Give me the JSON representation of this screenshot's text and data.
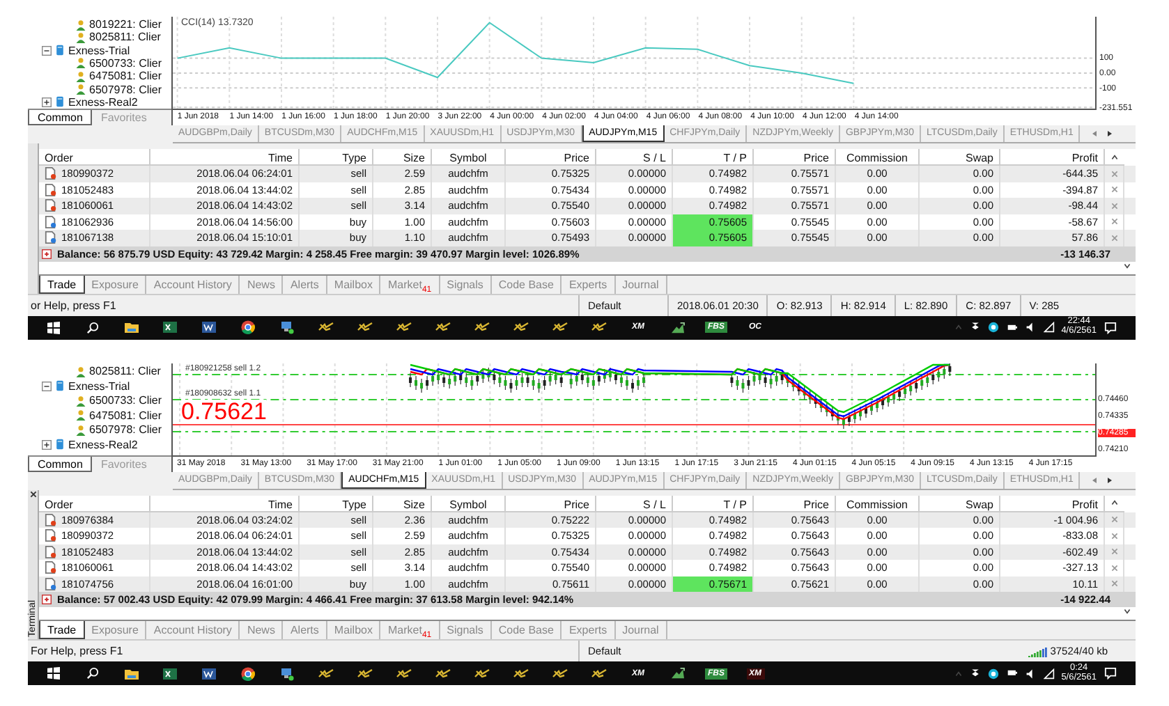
{
  "screens": [
    {
      "navigator": {
        "items": [
          {
            "label": "8019221: Clier",
            "kind": "account"
          },
          {
            "label": "8025811: Clier",
            "kind": "account"
          },
          {
            "label": "Exness-Trial",
            "kind": "server",
            "expanded": true,
            "children": [
              {
                "label": "6500733: Clier",
                "kind": "account"
              },
              {
                "label": "6475081: Clier",
                "kind": "account"
              },
              {
                "label": "6507978: Clier",
                "kind": "account"
              }
            ]
          },
          {
            "label": "Exness-Real2",
            "kind": "server",
            "expanded": false
          }
        ],
        "tabs": [
          {
            "label": "Common",
            "selected": true
          },
          {
            "label": "Favorites",
            "selected": false
          }
        ]
      },
      "chart": {
        "kind": "indicator",
        "legend_value": "13.7320",
        "chart_data": {
          "type": "line",
          "ylim": [
            -240,
            380
          ],
          "grid": true,
          "categories": [
            "1 Jun 2018",
            "1 Jun 14:00",
            "1 Jun 16:00",
            "1 Jun 18:00",
            "1 Jun 20:00",
            "3 Jun 22:00",
            "4 Jun 00:00",
            "4 Jun 02:00",
            "4 Jun 04:00",
            "4 Jun 06:00",
            "4 Jun 08:00",
            "4 Jun 10:00",
            "4 Jun 12:00",
            "4 Jun 14:00"
          ],
          "yticks": [
            {
              "value": 100,
              "label": "100"
            },
            {
              "value": 0,
              "label": "0.00"
            },
            {
              "value": -100,
              "label": "-100"
            },
            {
              "value": -231.551,
              "label": "-231.551"
            }
          ],
          "series": [
            {
              "name": "CCI(14)",
              "color": "#49c9c0",
              "values": [
                100,
                170,
                100,
                100,
                100,
                -30,
                340,
                100,
                70,
                170,
                160,
                50,
                0,
                -70
              ]
            }
          ]
        }
      },
      "chart_tabs": [
        {
          "label": "AUDGBPm,Daily",
          "selected": false
        },
        {
          "label": "BTCUSDm,M30",
          "selected": false
        },
        {
          "label": "AUDCHFm,M15",
          "selected": false
        },
        {
          "label": "XAUUSDm,H1",
          "selected": false
        },
        {
          "label": "USDJPYm,M30",
          "selected": false
        },
        {
          "label": "AUDJPYm,M15",
          "selected": true
        },
        {
          "label": "CHFJPYm,Daily",
          "selected": false
        },
        {
          "label": "NZDJPYm,Weekly",
          "selected": false
        },
        {
          "label": "GBPJPYm,M30",
          "selected": false
        },
        {
          "label": "LTCUSDm,Daily",
          "selected": false
        },
        {
          "label": "ETHUSDm,H1",
          "selected": false
        }
      ],
      "table": {
        "columns": [
          "Order",
          "Time",
          "Type",
          "Size",
          "Symbol",
          "Price",
          "S / L",
          "T / P",
          "Price",
          "Commission",
          "Swap",
          "Profit"
        ],
        "rows": [
          {
            "kind": "sell",
            "order": "180990372",
            "time": "2018.06.04 06:24:01",
            "type": "sell",
            "size": "2.59",
            "symbol": "audchfm",
            "price": "0.75325",
            "sl": "0.00000",
            "tp": "0.74982",
            "tp_hit": false,
            "current": "0.75571",
            "commission": "0.00",
            "swap": "0.00",
            "profit": "-644.35"
          },
          {
            "kind": "sell",
            "order": "181052483",
            "time": "2018.06.04 13:44:02",
            "type": "sell",
            "size": "2.85",
            "symbol": "audchfm",
            "price": "0.75434",
            "sl": "0.00000",
            "tp": "0.74982",
            "tp_hit": false,
            "current": "0.75571",
            "commission": "0.00",
            "swap": "0.00",
            "profit": "-394.87"
          },
          {
            "kind": "sell",
            "order": "181060061",
            "time": "2018.06.04 14:43:02",
            "type": "sell",
            "size": "3.14",
            "symbol": "audchfm",
            "price": "0.75540",
            "sl": "0.00000",
            "tp": "0.74982",
            "tp_hit": false,
            "current": "0.75571",
            "commission": "0.00",
            "swap": "0.00",
            "profit": "-98.44"
          },
          {
            "kind": "buy",
            "order": "181062936",
            "time": "2018.06.04 14:56:00",
            "type": "buy",
            "size": "1.00",
            "symbol": "audchfm",
            "price": "0.75603",
            "sl": "0.00000",
            "tp": "0.75605",
            "tp_hit": true,
            "current": "0.75545",
            "commission": "0.00",
            "swap": "0.00",
            "profit": "-58.67"
          },
          {
            "kind": "buy",
            "order": "181067138",
            "time": "2018.06.04 15:10:01",
            "type": "buy",
            "size": "1.10",
            "symbol": "audchfm",
            "price": "0.75493",
            "sl": "0.00000",
            "tp": "0.75605",
            "tp_hit": true,
            "current": "0.75545",
            "commission": "0.00",
            "swap": "0.00",
            "profit": "57.86"
          }
        ],
        "summary": "Balance: 56 875.79 USD  Equity: 43 729.42  Margin: 4 258.45  Free margin: 39 470.97  Margin level: 1026.89%",
        "total": "-13 146.37"
      },
      "terminal_tabs": [
        {
          "label": "Trade",
          "selected": true
        },
        {
          "label": "Exposure",
          "selected": false
        },
        {
          "label": "Account History",
          "selected": false
        },
        {
          "label": "News",
          "selected": false
        },
        {
          "label": "Alerts",
          "selected": false
        },
        {
          "label": "Mailbox",
          "selected": false
        },
        {
          "label": "Market",
          "badge": "41",
          "selected": false
        },
        {
          "label": "Signals",
          "selected": false
        },
        {
          "label": "Code Base",
          "selected": false
        },
        {
          "label": "Experts",
          "selected": false
        },
        {
          "label": "Journal",
          "selected": false
        }
      ],
      "status": {
        "help": "or Help, press F1",
        "cells": [
          "Default",
          "2018.06.01 20:30",
          "O: 82.913",
          "H: 82.914",
          "L: 82.890",
          "C: 82.897",
          "V: 285"
        ]
      },
      "taskbar": {
        "apps": [
          {
            "kind": "start"
          },
          {
            "kind": "search"
          },
          {
            "kind": "folder"
          },
          {
            "kind": "excel"
          },
          {
            "kind": "word"
          },
          {
            "kind": "chrome"
          },
          {
            "kind": "network"
          },
          {
            "kind": "zx"
          },
          {
            "kind": "zx"
          },
          {
            "kind": "zx"
          },
          {
            "kind": "zx"
          },
          {
            "kind": "zx"
          },
          {
            "kind": "zx"
          },
          {
            "kind": "zx"
          },
          {
            "kind": "zx"
          },
          {
            "kind": "logo",
            "label": "XM",
            "color": "#0d0d0d"
          },
          {
            "kind": "mountain"
          },
          {
            "kind": "logo",
            "label": "FBS",
            "color": "#2e8b3e"
          },
          {
            "kind": "logo",
            "label": "OC",
            "color": "#0d0d0d"
          }
        ],
        "time": "22:44",
        "date": "4/6/2561"
      }
    },
    {
      "navigator": {
        "items": [
          {
            "label": "8025811: Clier",
            "kind": "account"
          },
          {
            "label": "Exness-Trial",
            "kind": "server",
            "expanded": true,
            "children": [
              {
                "label": "6500733: Clier",
                "kind": "account"
              },
              {
                "label": "6475081: Clier",
                "kind": "account"
              },
              {
                "label": "6507978: Clier",
                "kind": "account"
              }
            ]
          },
          {
            "label": "Exness-Real2",
            "kind": "server",
            "expanded": false
          }
        ],
        "tabs": [
          {
            "label": "Common",
            "selected": true
          },
          {
            "label": "Favorites",
            "selected": false
          }
        ]
      },
      "chart": {
        "kind": "candles",
        "price": "0.75621",
        "trade_labels": [
          "#180921258 sell 1.2",
          "#180908632 sell 1.1"
        ],
        "x_labels": [
          "31 May 2018",
          "31 May 13:00",
          "31 May 17:00",
          "31 May 21:00",
          "1 Jun 01:00",
          "1 Jun 05:00",
          "1 Jun 09:00",
          "1 Jun 13:15",
          "1 Jun 17:15",
          "3 Jun 21:15",
          "4 Jun 01:15",
          "4 Jun 05:15",
          "4 Jun 09:15",
          "4 Jun 13:15",
          "4 Jun 17:15"
        ],
        "y_labels": [
          {
            "text": "0.74460",
            "highlight": false
          },
          {
            "text": "0.74335",
            "highlight": false
          },
          {
            "text": "0.74285",
            "highlight": true
          },
          {
            "text": "0.74210",
            "highlight": false
          }
        ]
      },
      "chart_tabs": [
        {
          "label": "AUDGBPm,Daily",
          "selected": false
        },
        {
          "label": "BTCUSDm,M30",
          "selected": false
        },
        {
          "label": "AUDCHFm,M15",
          "selected": true
        },
        {
          "label": "XAUUSDm,H1",
          "selected": false
        },
        {
          "label": "USDJPYm,M30",
          "selected": false
        },
        {
          "label": "AUDJPYm,M15",
          "selected": false
        },
        {
          "label": "CHFJPYm,Daily",
          "selected": false
        },
        {
          "label": "NZDJPYm,Weekly",
          "selected": false
        },
        {
          "label": "GBPJPYm,M30",
          "selected": false
        },
        {
          "label": "LTCUSDm,Daily",
          "selected": false
        },
        {
          "label": "ETHUSDm,H1",
          "selected": false
        }
      ],
      "terminal_label": "Terminal",
      "table": {
        "columns": [
          "Order",
          "Time",
          "Type",
          "Size",
          "Symbol",
          "Price",
          "S / L",
          "T / P",
          "Price",
          "Commission",
          "Swap",
          "Profit"
        ],
        "rows": [
          {
            "kind": "sell",
            "order": "180976384",
            "time": "2018.06.04 03:24:02",
            "type": "sell",
            "size": "2.36",
            "symbol": "audchfm",
            "price": "0.75222",
            "sl": "0.00000",
            "tp": "0.74982",
            "tp_hit": false,
            "current": "0.75643",
            "commission": "0.00",
            "swap": "0.00",
            "profit": "-1 004.96"
          },
          {
            "kind": "sell",
            "order": "180990372",
            "time": "2018.06.04 06:24:01",
            "type": "sell",
            "size": "2.59",
            "symbol": "audchfm",
            "price": "0.75325",
            "sl": "0.00000",
            "tp": "0.74982",
            "tp_hit": false,
            "current": "0.75643",
            "commission": "0.00",
            "swap": "0.00",
            "profit": "-833.08"
          },
          {
            "kind": "sell",
            "order": "181052483",
            "time": "2018.06.04 13:44:02",
            "type": "sell",
            "size": "2.85",
            "symbol": "audchfm",
            "price": "0.75434",
            "sl": "0.00000",
            "tp": "0.74982",
            "tp_hit": false,
            "current": "0.75643",
            "commission": "0.00",
            "swap": "0.00",
            "profit": "-602.49"
          },
          {
            "kind": "sell",
            "order": "181060061",
            "time": "2018.06.04 14:43:02",
            "type": "sell",
            "size": "3.14",
            "symbol": "audchfm",
            "price": "0.75540",
            "sl": "0.00000",
            "tp": "0.74982",
            "tp_hit": false,
            "current": "0.75643",
            "commission": "0.00",
            "swap": "0.00",
            "profit": "-327.13"
          },
          {
            "kind": "buy",
            "order": "181074756",
            "time": "2018.06.04 16:01:00",
            "type": "buy",
            "size": "1.00",
            "symbol": "audchfm",
            "price": "0.75611",
            "sl": "0.00000",
            "tp": "0.75671",
            "tp_hit": true,
            "current": "0.75621",
            "commission": "0.00",
            "swap": "0.00",
            "profit": "10.11"
          }
        ],
        "summary": "Balance: 57 002.43 USD  Equity: 42 079.99  Margin: 4 466.41  Free margin: 37 613.58  Margin level: 942.14%",
        "total": "-14 922.44"
      },
      "terminal_tabs": [
        {
          "label": "Trade",
          "selected": true
        },
        {
          "label": "Exposure",
          "selected": false
        },
        {
          "label": "Account History",
          "selected": false
        },
        {
          "label": "News",
          "selected": false
        },
        {
          "label": "Alerts",
          "selected": false
        },
        {
          "label": "Mailbox",
          "selected": false
        },
        {
          "label": "Market",
          "badge": "41",
          "selected": false
        },
        {
          "label": "Signals",
          "selected": false
        },
        {
          "label": "Code Base",
          "selected": false
        },
        {
          "label": "Experts",
          "selected": false
        },
        {
          "label": "Journal",
          "selected": false
        }
      ],
      "status": {
        "help": "For Help, press F1",
        "cells": [
          "Default"
        ],
        "traffic": "37524/40 kb"
      },
      "taskbar": {
        "apps": [
          {
            "kind": "start"
          },
          {
            "kind": "search"
          },
          {
            "kind": "folder"
          },
          {
            "kind": "excel"
          },
          {
            "kind": "word"
          },
          {
            "kind": "chrome"
          },
          {
            "kind": "network"
          },
          {
            "kind": "zx"
          },
          {
            "kind": "zx"
          },
          {
            "kind": "zx"
          },
          {
            "kind": "zx"
          },
          {
            "kind": "zx"
          },
          {
            "kind": "zx"
          },
          {
            "kind": "zx"
          },
          {
            "kind": "zx"
          },
          {
            "kind": "logo",
            "label": "XM",
            "color": "#0d0d0d"
          },
          {
            "kind": "mountain"
          },
          {
            "kind": "logo",
            "label": "FBS",
            "color": "#2e8b3e"
          },
          {
            "kind": "logo",
            "label": "XM",
            "color": "#3a0a0a"
          }
        ],
        "time": "0:24",
        "date": "5/6/2561"
      }
    }
  ]
}
